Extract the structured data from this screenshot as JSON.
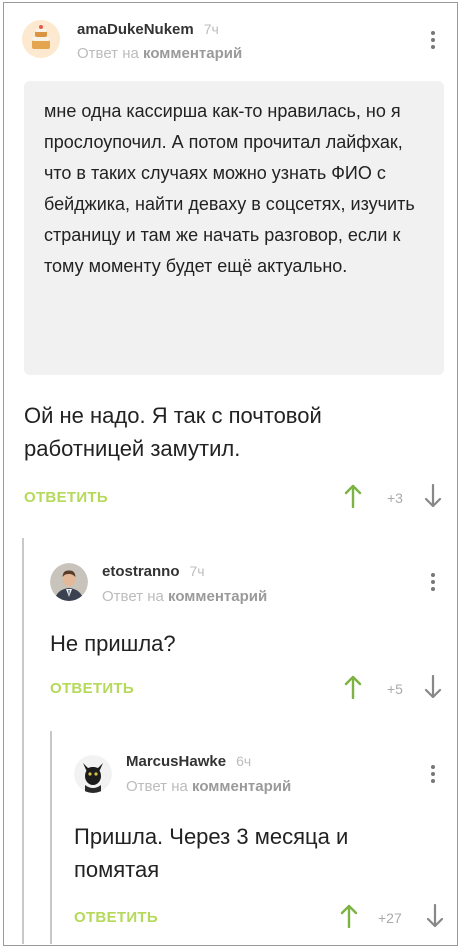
{
  "comments": [
    {
      "username": "amaDukeNukem",
      "time": "7ч",
      "reply_prefix": "Ответ на",
      "reply_link": "комментарий",
      "quote": "мне одна кассирша как-то нравилась, но я прослоупочил. А потом прочитал лайфхак, что в таких случаях можно узнать ФИО с бейджика, найти деваху в соцсетях, изучить страницу и там же начать разговор, если к тому моменту будет ещё актуально.",
      "text": "Ой не надо. Я так с почтовой работницей замутил.",
      "reply_label": "ОТВЕТИТЬ",
      "score": "+3",
      "avatar": "cake-avatar"
    },
    {
      "username": "etostranno",
      "time": "7ч",
      "reply_prefix": "Ответ на",
      "reply_link": "комментарий",
      "text": "Не пришла?",
      "reply_label": "ОТВЕТИТЬ",
      "score": "+5",
      "avatar": "man-in-suit-avatar"
    },
    {
      "username": "MarcusHawke",
      "time": "6ч",
      "reply_prefix": "Ответ на",
      "reply_link": "комментарий",
      "text": "Пришла. Через 3 месяца и помятая",
      "reply_label": "ОТВЕТИТЬ",
      "score": "+27",
      "avatar": "black-cat-avatar"
    }
  ],
  "colors": {
    "accent_green": "#b5d95a",
    "vote_up": "#7cb342",
    "muted": "#bcbcbc"
  },
  "icons": [
    "more-vertical-icon",
    "arrow-up-icon",
    "arrow-down-icon"
  ]
}
